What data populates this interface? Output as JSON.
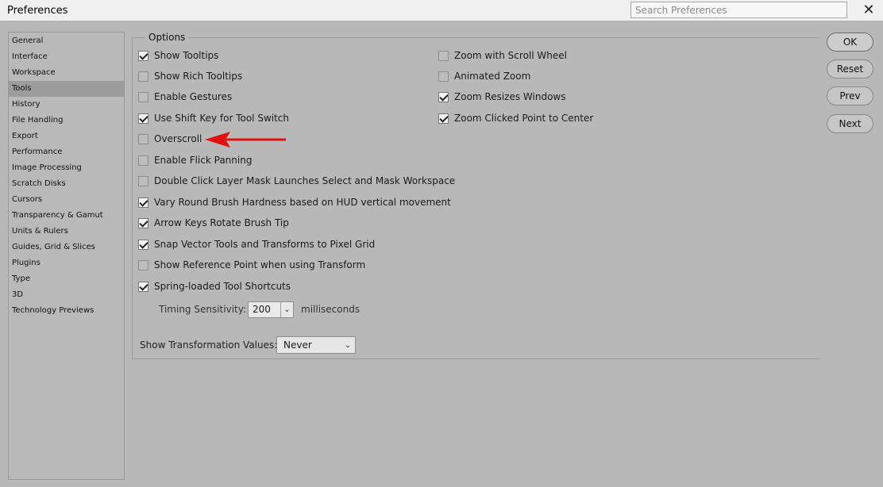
{
  "window": {
    "title": "Preferences",
    "search_placeholder": "Search Preferences",
    "close_glyph": "✕"
  },
  "sidebar": {
    "items": [
      {
        "label": "General"
      },
      {
        "label": "Interface"
      },
      {
        "label": "Workspace"
      },
      {
        "label": "Tools",
        "selected": true
      },
      {
        "label": "History"
      },
      {
        "label": "File Handling"
      },
      {
        "label": "Export"
      },
      {
        "label": "Performance"
      },
      {
        "label": "Image Processing"
      },
      {
        "label": "Scratch Disks"
      },
      {
        "label": "Cursors"
      },
      {
        "label": "Transparency & Gamut"
      },
      {
        "label": "Units & Rulers"
      },
      {
        "label": "Guides, Grid & Slices"
      },
      {
        "label": "Plugins"
      },
      {
        "label": "Type"
      },
      {
        "label": "3D"
      },
      {
        "label": "Technology Previews"
      }
    ]
  },
  "options": {
    "legend": "Options",
    "left": [
      {
        "label": "Show Tooltips",
        "checked": true
      },
      {
        "label": "Show Rich Tooltips",
        "checked": false
      },
      {
        "label": "Enable Gestures",
        "checked": false
      },
      {
        "label": "Use Shift Key for Tool Switch",
        "checked": true
      },
      {
        "label": "Overscroll",
        "checked": false
      },
      {
        "label": "Enable Flick Panning",
        "checked": false
      },
      {
        "label": "Double Click Layer Mask Launches Select and Mask Workspace",
        "checked": false
      },
      {
        "label": "Vary Round Brush Hardness based on HUD vertical movement",
        "checked": true
      },
      {
        "label": "Arrow Keys Rotate Brush Tip",
        "checked": true
      },
      {
        "label": "Snap Vector Tools and Transforms to Pixel Grid",
        "checked": true
      },
      {
        "label": "Show Reference Point when using Transform",
        "checked": false
      },
      {
        "label": "Spring-loaded Tool Shortcuts",
        "checked": true
      }
    ],
    "right": [
      {
        "label": "Zoom with Scroll Wheel",
        "checked": false
      },
      {
        "label": "Animated Zoom",
        "checked": false
      },
      {
        "label": "Zoom Resizes Windows",
        "checked": true
      },
      {
        "label": "Zoom Clicked Point to Center",
        "checked": true
      }
    ],
    "timing": {
      "label": "Timing Sensitivity:",
      "value": "200",
      "unit": "milliseconds"
    },
    "transform_values": {
      "label": "Show Transformation Values:",
      "value": "Never"
    }
  },
  "buttons": {
    "ok": "OK",
    "reset": "Reset",
    "prev": "Prev",
    "next": "Next"
  },
  "colors": {
    "annotation_arrow": "#e01010",
    "selected_item": "#9c9c9c",
    "window_bg": "#b8b8b8"
  }
}
